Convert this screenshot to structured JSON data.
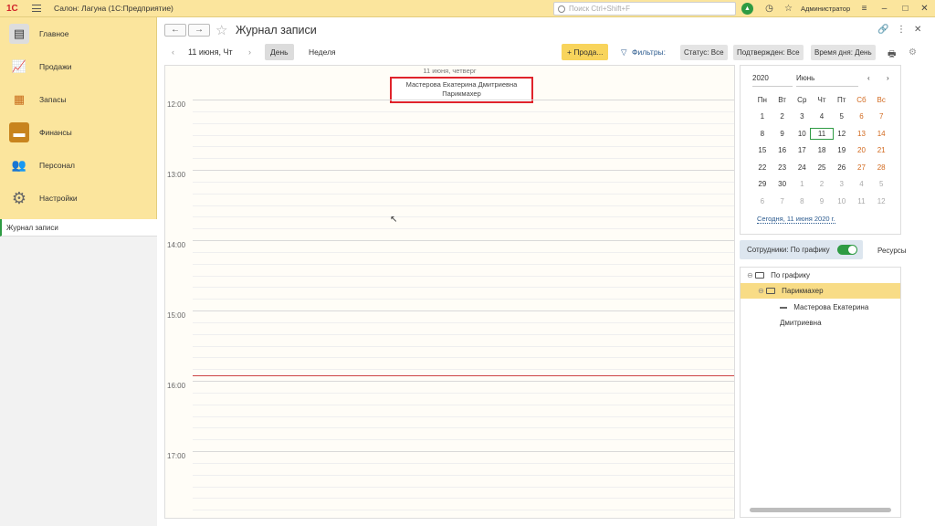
{
  "app": {
    "logo": "1С",
    "title": "Салон: Лагуна  (1С:Предприятие)",
    "search_placeholder": "Поиск Ctrl+Shift+F",
    "user": "Администратор"
  },
  "sidebar": {
    "sections": [
      {
        "label": "Главное",
        "icon": "main-icon"
      },
      {
        "label": "Продажи",
        "icon": "sales-icon"
      },
      {
        "label": "Запасы",
        "icon": "stock-icon"
      },
      {
        "label": "Финансы",
        "icon": "wallet-icon"
      },
      {
        "label": "Персонал",
        "icon": "people-icon"
      },
      {
        "label": "Настройки",
        "icon": "gear-icon"
      }
    ],
    "open_tab": "Журнал записи"
  },
  "main": {
    "title": "Журнал записи",
    "date": "11 июня, Чт",
    "view_day": "День",
    "view_week": "Неделя",
    "add_button": "+ Прода...",
    "filters_label": "Фильтры:",
    "chips": [
      "Статус: Все",
      "Подтвержден: Все",
      "Время дня: День"
    ]
  },
  "schedule": {
    "header": "11 июня, четверг",
    "appointment": {
      "line1": "Мастерова Екатерина Дмитриевна",
      "line2": "Парикмахер"
    },
    "hours": [
      "12:00",
      "13:00",
      "14:00",
      "15:00",
      "16:00",
      "17:00"
    ]
  },
  "calendar": {
    "year": "2020",
    "month": "Июнь",
    "weekdays": [
      "Пн",
      "Вт",
      "Ср",
      "Чт",
      "Пт",
      "Сб",
      "Вс"
    ],
    "weeks": [
      [
        "1",
        "2",
        "3",
        "4",
        "5",
        "6",
        "7"
      ],
      [
        "8",
        "9",
        "10",
        "11",
        "12",
        "13",
        "14"
      ],
      [
        "15",
        "16",
        "17",
        "18",
        "19",
        "20",
        "21"
      ],
      [
        "22",
        "23",
        "24",
        "25",
        "26",
        "27",
        "28"
      ],
      [
        "29",
        "30",
        "1",
        "2",
        "3",
        "4",
        "5"
      ],
      [
        "6",
        "7",
        "8",
        "9",
        "10",
        "11",
        "12"
      ]
    ],
    "today_link": "Сегодня, 11 июня 2020 г."
  },
  "employees": {
    "toggle_label": "Сотрудники: По графику",
    "resources_label": "Ресурсы",
    "tree": [
      {
        "label": "По графику",
        "level": 0
      },
      {
        "label": "Парикмахер",
        "level": 1
      },
      {
        "label": "Мастерова Екатерина Дмитриевна",
        "level": 2
      }
    ]
  },
  "colors": {
    "accent_yellow": "#fbe59d",
    "green": "#2e9b43",
    "highlight_red": "#e0232b",
    "weekend": "#d2691e"
  }
}
